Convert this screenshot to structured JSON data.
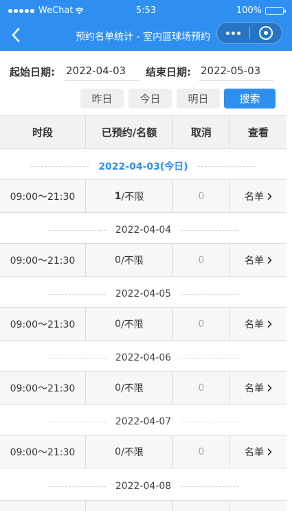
{
  "status_bar": {
    "carrier": "WeChat",
    "time": "5:53",
    "battery": "100%"
  },
  "nav": {
    "title": "预约名单统计 - 室内篮球场预约"
  },
  "filters": {
    "start_label": "起始日期:",
    "start_value": "2022-04-03",
    "end_label": "结束日期:",
    "end_value": "2022-05-03",
    "buttons": {
      "yesterday": "昨日",
      "today": "今日",
      "tomorrow": "明日",
      "search": "搜索"
    }
  },
  "table": {
    "headers": [
      "时段",
      "已预约/名额",
      "取消",
      "查看"
    ],
    "days": [
      {
        "date": "2022-04-03(今日)",
        "slot": "09:00～21:30",
        "booked": "1",
        "quota": "/不限",
        "cancel": "0",
        "view": "名单"
      },
      {
        "date": "2022-04-04",
        "slot": "09:00～21:30",
        "booked": "0",
        "quota": "/不限",
        "cancel": "0",
        "view": "名单"
      },
      {
        "date": "2022-04-05",
        "slot": "09:00～21:30",
        "booked": "0",
        "quota": "/不限",
        "cancel": "0",
        "view": "名单"
      },
      {
        "date": "2022-04-06",
        "slot": "09:00～21:30",
        "booked": "0",
        "quota": "/不限",
        "cancel": "0",
        "view": "名单"
      },
      {
        "date": "2022-04-07",
        "slot": "09:00～21:30",
        "booked": "0",
        "quota": "/不限",
        "cancel": "0",
        "view": "名单"
      },
      {
        "date": "2022-04-08"
      }
    ]
  },
  "colors": {
    "accent": "#2f8ff0",
    "header_bg": "#f2f2f2",
    "row_bg": "#f7f7f7"
  }
}
